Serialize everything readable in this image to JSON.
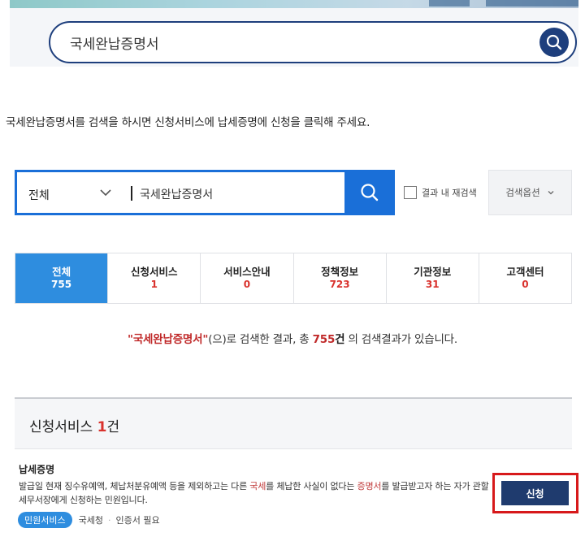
{
  "hero_search": {
    "value": "국세완납증명서",
    "icon": "search-icon",
    "color": "#1e3f7d"
  },
  "notice": "국세완납증명서를 검색을 하시면 신청서비스에 납세증명에 신청을 클릭해 주세요.",
  "search": {
    "category": "전체",
    "query": "국세완납증명서",
    "search_icon": "search-icon",
    "accent": "#1a6fd8",
    "research_label": "결과 내 재검색",
    "research_checked": false,
    "options_label": "검색옵션"
  },
  "tabs": [
    {
      "label": "전체",
      "count": "755",
      "active": true
    },
    {
      "label": "신청서비스",
      "count": "1",
      "active": false
    },
    {
      "label": "서비스안내",
      "count": "0",
      "active": false
    },
    {
      "label": "정책정보",
      "count": "723",
      "active": false
    },
    {
      "label": "기관정보",
      "count": "31",
      "active": false
    },
    {
      "label": "고객센터",
      "count": "0",
      "active": false
    }
  ],
  "summary": {
    "query": "\"국세완납증명서\"",
    "text1": "(으)로 검색한 결과, 총 ",
    "total": "755",
    "unit": "건",
    "text2": " 의 검색결과가 있습니다."
  },
  "section": {
    "title": "신청서비스",
    "count": "1",
    "unit": "건"
  },
  "result": {
    "title": "납세증명",
    "desc_1": "발급일 현재 징수유예액, 체납처분유예액 등을 제외하고는 다른 ",
    "desc_hl1": "국세",
    "desc_2": "를 체납한 사실이 없다는 ",
    "desc_hl2": "증명서",
    "desc_3": "를 발급받고자 하는 자가 관할 세무서장에게 신청하는 민원입니다.",
    "badge": "민원서비스",
    "agency": "국세청",
    "cert": "인증서 필요",
    "apply_label": "신청",
    "highlight_color": "#d7191b"
  }
}
